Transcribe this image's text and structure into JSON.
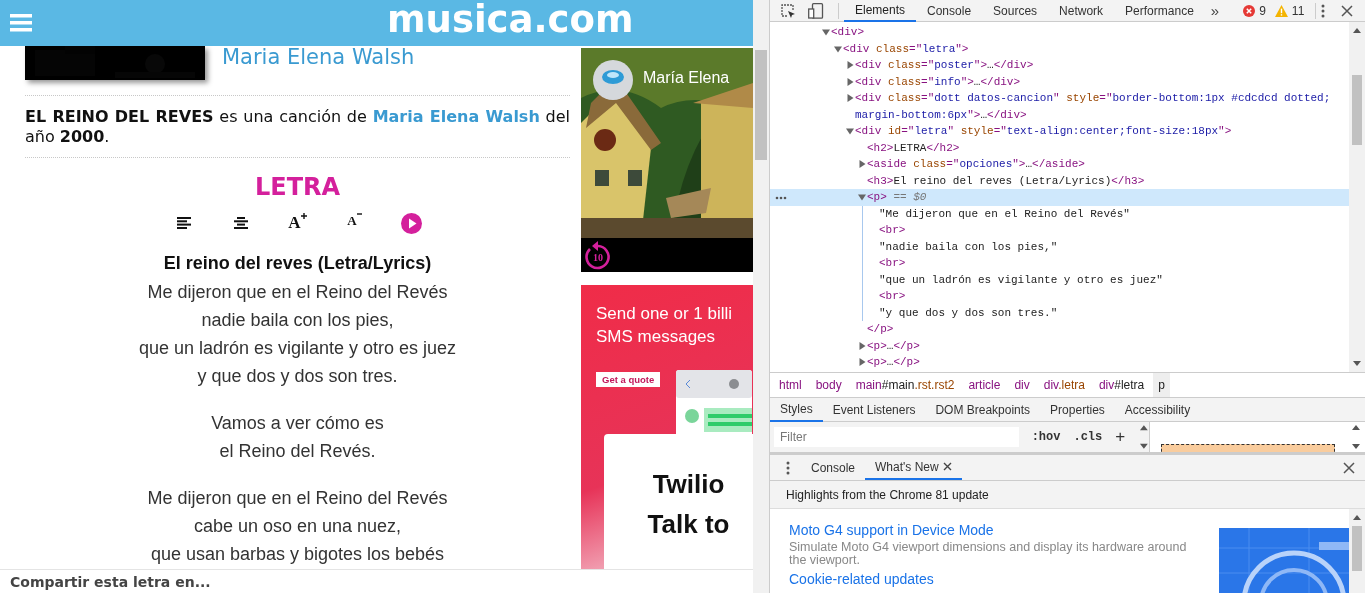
{
  "site": {
    "logo": "musica.com"
  },
  "artist_name": "Maria Elena Walsh",
  "intro": {
    "before": "**EL REINO DEL REVES** es una canción de ",
    "link": "Maria Elena Walsh",
    "after": " del año **2000**."
  },
  "lyrics": {
    "heading": "LETRA",
    "tools": [
      {
        "kind": "align-left"
      },
      {
        "kind": "align-center"
      },
      {
        "kind": "font-larger",
        "label": "A"
      },
      {
        "kind": "font-smaller",
        "label": "A"
      },
      {
        "kind": "play"
      }
    ],
    "title": "El reino del reves (Letra/Lyrics)",
    "stanzas": [
      [
        "Me dijeron que en el Reino del Revés",
        "nadie baila con los pies,",
        "que un ladrón es vigilante y otro es juez",
        "y que dos y dos son tres."
      ],
      [
        "Vamos a ver cómo es",
        "el Reino del Revés."
      ],
      [
        "Me dijeron que en el Reino del Revés",
        "cabe un oso en una nuez,",
        "que usan barbas y bigotes los bebés"
      ]
    ]
  },
  "video": {
    "title": "María Elena",
    "replay_label": "10"
  },
  "ad": {
    "headline": [
      "Send one or 1 billi",
      "SMS messages"
    ],
    "button": "Get a quote",
    "card_lines": [
      "Twilio",
      "Talk to"
    ]
  },
  "share_bar": "Compartir esta letra en...",
  "devtools": {
    "tabs": [
      {
        "label": "Elements",
        "selected": true
      },
      {
        "label": "Console",
        "selected": false
      },
      {
        "label": "Sources",
        "selected": false
      },
      {
        "label": "Network",
        "selected": false
      },
      {
        "label": "Performance",
        "selected": false
      }
    ],
    "more": "»",
    "errors": "9",
    "warnings": "11",
    "dom_tree": [
      {
        "selected": false,
        "expanded": true,
        "segments": [
          {
            "kind": "tag",
            "s": "<div>"
          }
        ],
        "children": [
          {
            "selected": false,
            "expanded": true,
            "segments": [
              {
                "kind": "tag",
                "s": "<div "
              },
              {
                "kind": "attr",
                "s": "class"
              },
              {
                "kind": "tag",
                "s": "=\""
              },
              {
                "kind": "value",
                "s": "letra"
              },
              {
                "kind": "tag",
                "s": "\">"
              }
            ],
            "children": [
              {
                "selected": false,
                "expanded": false,
                "segments": [
                  {
                    "kind": "tag",
                    "s": "<div "
                  },
                  {
                    "kind": "attr",
                    "s": "class"
                  },
                  {
                    "kind": "tag",
                    "s": "=\""
                  },
                  {
                    "kind": "value",
                    "s": "poster"
                  },
                  {
                    "kind": "tag",
                    "s": "\">"
                  },
                  {
                    "kind": "text",
                    "s": "…"
                  },
                  {
                    "kind": "tag",
                    "s": "</div>"
                  }
                ]
              },
              {
                "selected": false,
                "expanded": false,
                "segments": [
                  {
                    "kind": "tag",
                    "s": "<div "
                  },
                  {
                    "kind": "attr",
                    "s": "class"
                  },
                  {
                    "kind": "tag",
                    "s": "=\""
                  },
                  {
                    "kind": "value",
                    "s": "info"
                  },
                  {
                    "kind": "tag",
                    "s": "\">"
                  },
                  {
                    "kind": "text",
                    "s": "…"
                  },
                  {
                    "kind": "tag",
                    "s": "</div>"
                  }
                ]
              },
              {
                "selected": false,
                "expanded": false,
                "segments": [
                  {
                    "kind": "tag",
                    "s": "<div "
                  },
                  {
                    "kind": "attr",
                    "s": "class"
                  },
                  {
                    "kind": "tag",
                    "s": "=\""
                  },
                  {
                    "kind": "value",
                    "s": "dott datos-cancion"
                  },
                  {
                    "kind": "tag",
                    "s": "\" "
                  },
                  {
                    "kind": "attr",
                    "s": "style"
                  },
                  {
                    "kind": "tag",
                    "s": "=\""
                  },
                  {
                    "kind": "value",
                    "s": "border-bottom:1px #cdcdcd dotted; margin-bottom:6px"
                  },
                  {
                    "kind": "tag",
                    "s": "\">"
                  },
                  {
                    "kind": "text",
                    "s": "…"
                  },
                  {
                    "kind": "tag",
                    "s": "</div>"
                  }
                ]
              },
              {
                "selected": false,
                "expanded": true,
                "segments": [
                  {
                    "kind": "tag",
                    "s": "<div "
                  },
                  {
                    "kind": "attr",
                    "s": "id"
                  },
                  {
                    "kind": "tag",
                    "s": "=\""
                  },
                  {
                    "kind": "value",
                    "s": "letra"
                  },
                  {
                    "kind": "tag",
                    "s": "\" "
                  },
                  {
                    "kind": "attr",
                    "s": "style"
                  },
                  {
                    "kind": "tag",
                    "s": "=\""
                  },
                  {
                    "kind": "value",
                    "s": "text-align:center;font-size:18px"
                  },
                  {
                    "kind": "tag",
                    "s": "\">"
                  }
                ],
                "children": [
                  {
                    "selected": false,
                    "segments": [
                      {
                        "kind": "tag",
                        "s": "<h2>"
                      },
                      {
                        "kind": "text",
                        "s": "LETRA"
                      },
                      {
                        "kind": "tag",
                        "s": "</h2>"
                      }
                    ]
                  },
                  {
                    "selected": false,
                    "expanded": false,
                    "segments": [
                      {
                        "kind": "tag",
                        "s": "<aside "
                      },
                      {
                        "kind": "attr",
                        "s": "class"
                      },
                      {
                        "kind": "tag",
                        "s": "=\""
                      },
                      {
                        "kind": "value",
                        "s": "opciones"
                      },
                      {
                        "kind": "tag",
                        "s": "\">"
                      },
                      {
                        "kind": "text",
                        "s": "…"
                      },
                      {
                        "kind": "tag",
                        "s": "</aside>"
                      }
                    ]
                  },
                  {
                    "selected": false,
                    "segments": [
                      {
                        "kind": "tag",
                        "s": "<h3>"
                      },
                      {
                        "kind": "text",
                        "s": "El reino del reves (Letra/Lyrics)"
                      },
                      {
                        "kind": "tag",
                        "s": "</h3>"
                      }
                    ]
                  },
                  {
                    "selected": true,
                    "expanded": true,
                    "segments": [
                      {
                        "kind": "tag",
                        "s": "<p>"
                      },
                      {
                        "kind": "ref",
                        "s": " == $0"
                      }
                    ],
                    "close": [
                      {
                        "kind": "tag",
                        "s": "</p>"
                      }
                    ],
                    "children": [
                      {
                        "selected": false,
                        "segments": [
                          {
                            "kind": "text",
                            "s": "\"Me dijeron que en el Reino del Revés\""
                          }
                        ]
                      },
                      {
                        "selected": false,
                        "segments": [
                          {
                            "kind": "tag",
                            "s": "<br>"
                          }
                        ]
                      },
                      {
                        "selected": false,
                        "segments": [
                          {
                            "kind": "text",
                            "s": "\"nadie baila con los pies,\""
                          }
                        ]
                      },
                      {
                        "selected": false,
                        "segments": [
                          {
                            "kind": "tag",
                            "s": "<br>"
                          }
                        ]
                      },
                      {
                        "selected": false,
                        "segments": [
                          {
                            "kind": "text",
                            "s": "\"que un ladrón es vigilante y otro es juez\""
                          }
                        ]
                      },
                      {
                        "selected": false,
                        "segments": [
                          {
                            "kind": "tag",
                            "s": "<br>"
                          }
                        ]
                      },
                      {
                        "selected": false,
                        "segments": [
                          {
                            "kind": "text",
                            "s": "\"y que dos y dos son tres.\""
                          }
                        ]
                      }
                    ]
                  },
                  {
                    "selected": false,
                    "expanded": false,
                    "segments": [
                      {
                        "kind": "tag",
                        "s": "<p>"
                      },
                      {
                        "kind": "text",
                        "s": "…"
                      },
                      {
                        "kind": "tag",
                        "s": "</p>"
                      }
                    ]
                  },
                  {
                    "selected": false,
                    "expanded": false,
                    "segments": [
                      {
                        "kind": "tag",
                        "s": "<p>"
                      },
                      {
                        "kind": "text",
                        "s": "…"
                      },
                      {
                        "kind": "tag",
                        "s": "</p>"
                      }
                    ]
                  }
                ]
              }
            ]
          }
        ]
      }
    ],
    "breadcrumbs": [
      {
        "selected": false,
        "segments": [
          {
            "kind": "tag",
            "s": "html"
          }
        ]
      },
      {
        "selected": false,
        "segments": [
          {
            "kind": "tag",
            "s": "body"
          }
        ]
      },
      {
        "selected": false,
        "segments": [
          {
            "kind": "tag",
            "s": "main"
          },
          {
            "kind": "text",
            "s": "#main"
          },
          {
            "kind": "attr",
            "s": ".rst.rst2"
          }
        ]
      },
      {
        "selected": false,
        "segments": [
          {
            "kind": "tag",
            "s": "article"
          }
        ]
      },
      {
        "selected": false,
        "segments": [
          {
            "kind": "tag",
            "s": "div"
          }
        ]
      },
      {
        "selected": false,
        "segments": [
          {
            "kind": "tag",
            "s": "div"
          },
          {
            "kind": "attr",
            "s": ".letra"
          }
        ]
      },
      {
        "selected": false,
        "segments": [
          {
            "kind": "tag",
            "s": "div"
          },
          {
            "kind": "text",
            "s": "#letra"
          }
        ]
      },
      {
        "selected": true,
        "segments": [
          {
            "kind": "text",
            "s": "p"
          }
        ]
      }
    ],
    "styles_tabs": [
      {
        "label": "Styles",
        "selected": true
      },
      {
        "label": "Event Listeners",
        "selected": false
      },
      {
        "label": "DOM Breakpoints",
        "selected": false
      },
      {
        "label": "Properties",
        "selected": false
      },
      {
        "label": "Accessibility",
        "selected": false
      }
    ],
    "filter": {
      "placeholder": "Filter"
    },
    "style_buttons": [
      ":hov",
      ".cls",
      "+"
    ],
    "drawer_tabs": [
      {
        "label": "Console",
        "selected": false,
        "closable": false
      },
      {
        "label": "What's New",
        "selected": true,
        "closable": true
      }
    ],
    "drawer_header": "Highlights from the Chrome 81 update",
    "news": [
      {
        "title": "Moto G4 support in Device Mode",
        "description": "Simulate Moto G4 viewport dimensions and display its hardware around the viewport."
      },
      {
        "title": "Cookie-related updates"
      }
    ]
  }
}
